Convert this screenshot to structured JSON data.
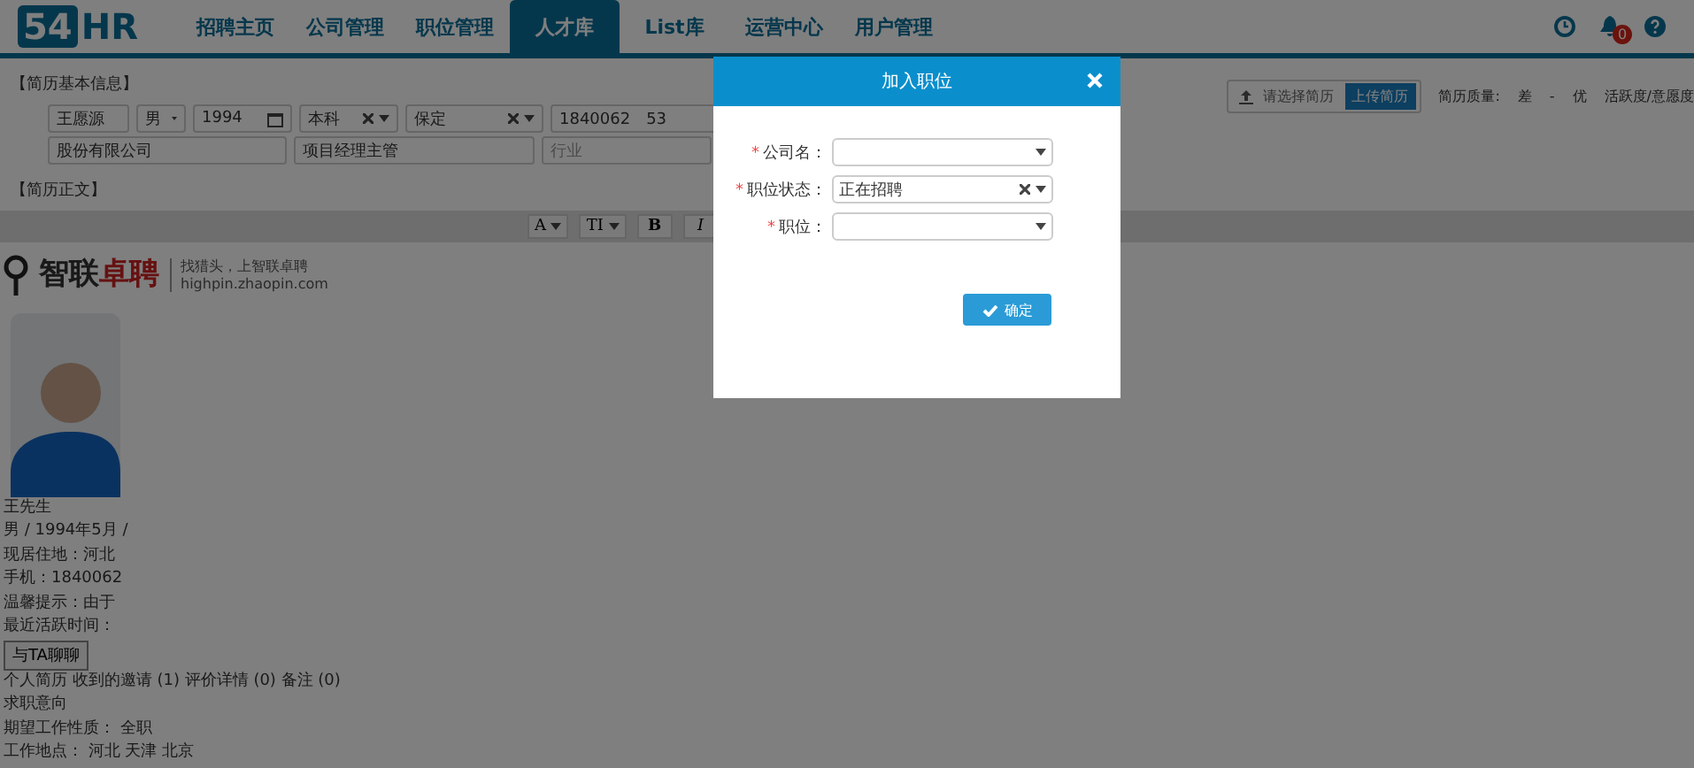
{
  "logo": {
    "number": "54",
    "letters": "HR"
  },
  "nav": [
    {
      "label": "招聘主页",
      "selected": false
    },
    {
      "label": "公司管理",
      "selected": false
    },
    {
      "label": "职位管理",
      "selected": false
    },
    {
      "label": "人才库",
      "selected": true
    },
    {
      "label": "List库",
      "selected": false
    },
    {
      "label": "运营中心",
      "selected": false
    },
    {
      "label": "用户管理",
      "selected": false
    }
  ],
  "notifications": {
    "count": "0"
  },
  "basic_info": {
    "title": "【简历基本信息】",
    "row_1": [
      {
        "kind": "text",
        "value": "王愿源"
      },
      {
        "kind": "select",
        "value": "男"
      },
      {
        "kind": "date",
        "value": "1994"
      },
      {
        "kind": "clear",
        "value": "本科"
      },
      {
        "kind": "clear",
        "value": "保定"
      },
      {
        "kind": "text",
        "value": "1840062　53"
      }
    ],
    "row_2": [
      {
        "kind": "text",
        "value": "股份有限公司"
      },
      {
        "kind": "text",
        "value": "项目经理主管"
      },
      {
        "kind": "placeholder",
        "value": "行业"
      }
    ],
    "upload": {
      "placeholder": "请选择简历",
      "button": "上传简历"
    },
    "quality": {
      "label": "简历质量:",
      "low": "差",
      "dash": "-",
      "high": "优",
      "activity": "活跃度/意愿度"
    }
  },
  "body": {
    "title": "【简历正文】",
    "toolbar": [
      {
        "kind": "font",
        "label": "A"
      },
      {
        "kind": "size",
        "label": "TI"
      },
      {
        "kind": "bold",
        "label": "B"
      },
      {
        "kind": "italic",
        "label": "I"
      }
    ],
    "brand": {
      "name_a": "智联",
      "name_b": "卓聘",
      "slogan": "找猎头，上智联卓聘",
      "url": "highpin.zhaopin.com"
    },
    "name": "王先生",
    "lines": [
      "男 / 1994年5月 /",
      "现居住地：河北",
      "手机：1840062",
      "温馨提示：由于",
      "最近活跃时间："
    ],
    "chat_button": "与TA聊聊",
    "tabs": "个人简历 收到的邀请 (1) 评价详情 (0) 备注 (0)",
    "section": "求职意向",
    "job_type": "期望工作性质：  全职",
    "location": "工作地点：  河北 天津 北京"
  },
  "dialog": {
    "title": "加入职位",
    "fields": [
      {
        "mark": "*",
        "label": "公司名：",
        "clearable": false
      },
      {
        "mark": "*",
        "label": "职位状态：",
        "value": "正在招聘",
        "clearable": true
      },
      {
        "mark": "*",
        "label": "职位：",
        "clearable": false
      }
    ],
    "confirm": "确定"
  }
}
